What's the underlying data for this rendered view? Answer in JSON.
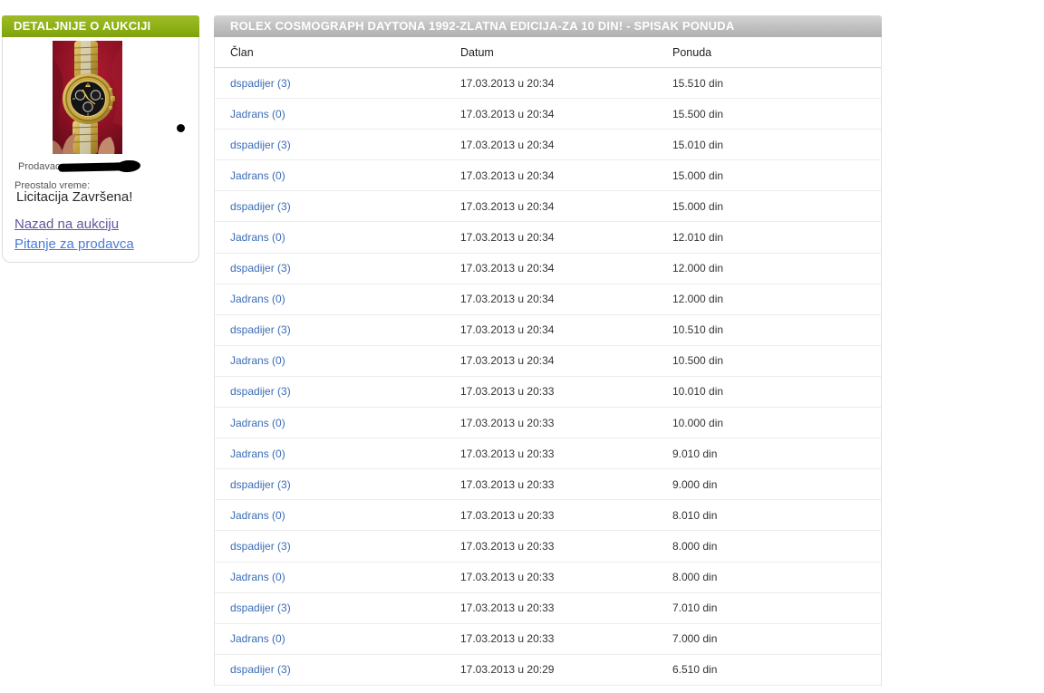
{
  "sidebar": {
    "header": "DETALJNIJE O AUKCIJI",
    "seller_label": "Prodavac:",
    "time_label": "Preostalo vreme:",
    "time_value": "Licitacija Završena!",
    "links": [
      {
        "label": "Nazad na aukciju"
      },
      {
        "label": "Pitanje za prodavca"
      }
    ]
  },
  "main": {
    "title": "ROLEX COSMOGRAPH DAYTONA 1992-ZLATNA EDICIJA-ZA 10 DIN! - SPISAK PONUDA",
    "table": {
      "columns": [
        "Član",
        "Datum",
        "Ponuda"
      ],
      "rows": [
        {
          "member": "dspadijer (3)",
          "date": "17.03.2013 u 20:34",
          "amount": "15.510 din"
        },
        {
          "member": "Jadrans (0)",
          "date": "17.03.2013 u 20:34",
          "amount": "15.500 din"
        },
        {
          "member": "dspadijer (3)",
          "date": "17.03.2013 u 20:34",
          "amount": "15.010 din"
        },
        {
          "member": "Jadrans (0)",
          "date": "17.03.2013 u 20:34",
          "amount": "15.000 din"
        },
        {
          "member": "dspadijer (3)",
          "date": "17.03.2013 u 20:34",
          "amount": "15.000 din"
        },
        {
          "member": "Jadrans (0)",
          "date": "17.03.2013 u 20:34",
          "amount": "12.010 din"
        },
        {
          "member": "dspadijer (3)",
          "date": "17.03.2013 u 20:34",
          "amount": "12.000 din"
        },
        {
          "member": "Jadrans (0)",
          "date": "17.03.2013 u 20:34",
          "amount": "12.000 din"
        },
        {
          "member": "dspadijer (3)",
          "date": "17.03.2013 u 20:34",
          "amount": "10.510 din"
        },
        {
          "member": "Jadrans (0)",
          "date": "17.03.2013 u 20:34",
          "amount": "10.500 din"
        },
        {
          "member": "dspadijer (3)",
          "date": "17.03.2013 u 20:33",
          "amount": "10.010 din"
        },
        {
          "member": "Jadrans (0)",
          "date": "17.03.2013 u 20:33",
          "amount": "10.000 din"
        },
        {
          "member": "Jadrans (0)",
          "date": "17.03.2013 u 20:33",
          "amount": "9.010 din"
        },
        {
          "member": "dspadijer (3)",
          "date": "17.03.2013 u 20:33",
          "amount": "9.000 din"
        },
        {
          "member": "Jadrans (0)",
          "date": "17.03.2013 u 20:33",
          "amount": "8.010 din"
        },
        {
          "member": "dspadijer (3)",
          "date": "17.03.2013 u 20:33",
          "amount": "8.000 din"
        },
        {
          "member": "Jadrans (0)",
          "date": "17.03.2013 u 20:33",
          "amount": "8.000 din"
        },
        {
          "member": "dspadijer (3)",
          "date": "17.03.2013 u 20:33",
          "amount": "7.010 din"
        },
        {
          "member": "Jadrans (0)",
          "date": "17.03.2013 u 20:33",
          "amount": "7.000 din"
        },
        {
          "member": "dspadijer (3)",
          "date": "17.03.2013 u 20:29",
          "amount": "6.510 din"
        }
      ]
    }
  },
  "colors": {
    "accent_green": "#8db115",
    "title_bar_gray": "#bdbdbd",
    "member_link_blue": "#3a6cb5",
    "sidebar_link_blue": "#4a7ad9",
    "sidebar_link_visited_purple": "#63569c"
  }
}
